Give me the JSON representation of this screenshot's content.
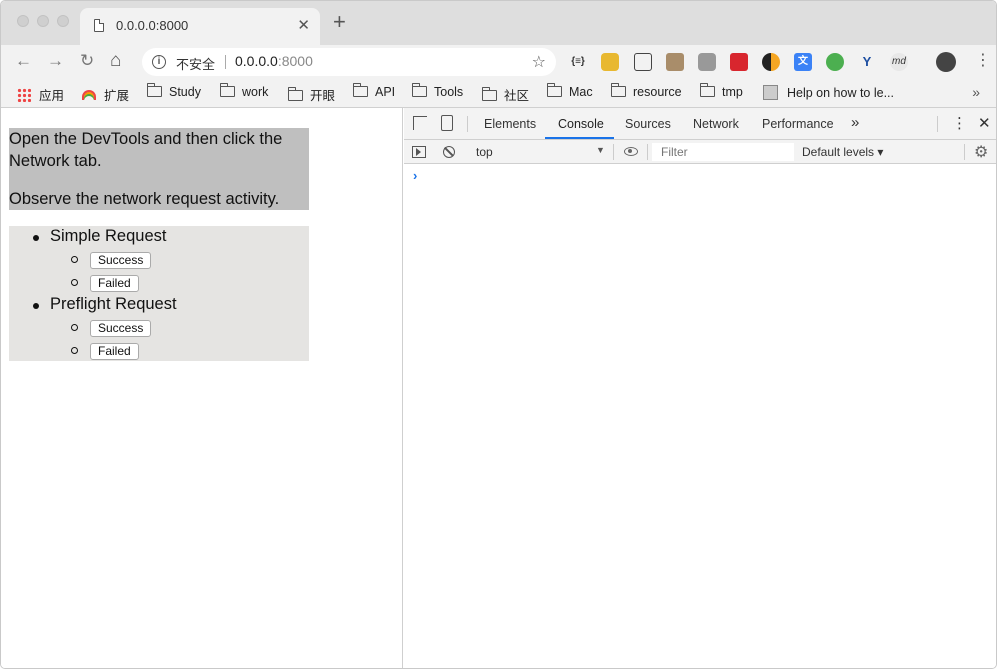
{
  "browser": {
    "tab": {
      "title": "0.0.0.0:8000",
      "close": "✕"
    },
    "new_tab": "+",
    "nav": {
      "back": "←",
      "forward": "→",
      "reload": "↻",
      "home": "⌂"
    },
    "omnibox": {
      "security_label": "不安全",
      "url_host": "0.0.0.0",
      "url_port": ":8000",
      "star": "☆"
    },
    "menu": "⋮",
    "extensions": [
      "json-formatter-icon",
      "lock-icon",
      "screenshot-icon",
      "image-icon",
      "camera-icon",
      "book-icon",
      "half-moon-icon",
      "translate-icon",
      "evernote-icon",
      "y-icon",
      "markdown-icon",
      "avatar"
    ]
  },
  "bookmarks": {
    "items": [
      {
        "label": "应用",
        "icon": "apps-grid-icon"
      },
      {
        "label": "扩展",
        "icon": "rainbow-icon"
      },
      {
        "label": "Study",
        "icon": "folder-icon"
      },
      {
        "label": "work",
        "icon": "folder-icon"
      },
      {
        "label": "开眼",
        "icon": "folder-icon"
      },
      {
        "label": "API",
        "icon": "folder-icon"
      },
      {
        "label": "Tools",
        "icon": "folder-icon"
      },
      {
        "label": "社区",
        "icon": "folder-icon"
      },
      {
        "label": "Mac",
        "icon": "folder-icon"
      },
      {
        "label": "resource",
        "icon": "folder-icon"
      },
      {
        "label": "tmp",
        "icon": "folder-icon"
      },
      {
        "label": "Help on how to le...",
        "icon": "page-icon"
      }
    ],
    "more": "»"
  },
  "page": {
    "intro_line1": "Open the DevTools and then click the Network tab.",
    "intro_line2": "Observe the network request activity.",
    "requests": [
      {
        "label": "Simple Request",
        "buttons": [
          "Success",
          "Failed"
        ]
      },
      {
        "label": "Preflight Request",
        "buttons": [
          "Success",
          "Failed"
        ]
      }
    ]
  },
  "devtools": {
    "tabs": [
      "Elements",
      "Console",
      "Sources",
      "Network",
      "Performance"
    ],
    "active_tab": "Console",
    "overflow": "»",
    "more": "⋮",
    "close": "✕",
    "context": "top",
    "filter_placeholder": "Filter",
    "levels": "Default levels ▾",
    "prompt": "›",
    "accent": "#1a73e8"
  }
}
